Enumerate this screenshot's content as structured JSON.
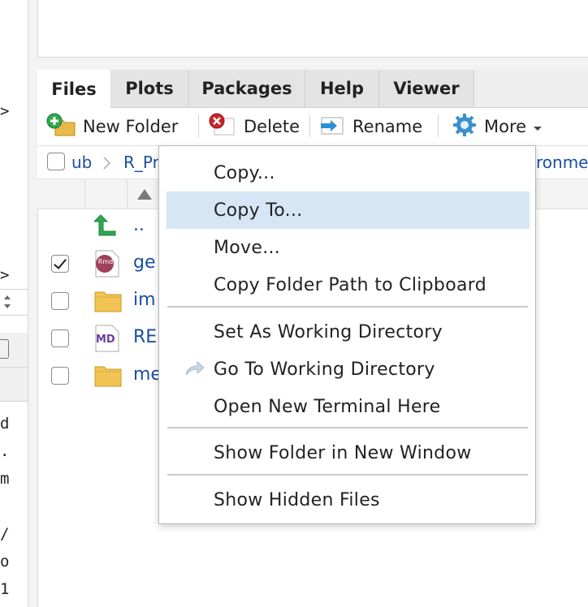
{
  "left_strip": {
    "prompts": [
      ">",
      ">"
    ],
    "mono_lines": [
      "d",
      ".",
      "m",
      "",
      "/",
      "o",
      "1"
    ]
  },
  "tabs": [
    {
      "label": "Files",
      "active": true
    },
    {
      "label": "Plots",
      "active": false
    },
    {
      "label": "Packages",
      "active": false
    },
    {
      "label": "Help",
      "active": false
    },
    {
      "label": "Viewer",
      "active": false
    }
  ],
  "toolbar": {
    "new_folder": "New Folder",
    "delete": "Delete",
    "rename": "Rename",
    "more": "More",
    "icons": {
      "new_folder": "folder-add-icon",
      "delete": "delete-icon",
      "rename": "rename-icon",
      "more": "gear-icon"
    }
  },
  "breadcrumb": {
    "items": [
      "ub",
      "R_Pr",
      "ronme"
    ]
  },
  "files": [
    {
      "name": "..",
      "icon": "up-arrow-icon",
      "checked": null
    },
    {
      "name": "ge",
      "icon": "rmd-file-icon",
      "checked": true
    },
    {
      "name": "im",
      "icon": "folder-icon",
      "checked": false
    },
    {
      "name": "RE",
      "icon": "md-file-icon",
      "checked": false
    },
    {
      "name": "me",
      "icon": "folder-icon",
      "checked": false
    }
  ],
  "icon_text": {
    "rmd": "Rmd",
    "md": "MD"
  },
  "context_menu": {
    "items": [
      "Copy...",
      "Copy To...",
      "Move...",
      "Copy Folder Path to Clipboard",
      "Set As Working Directory",
      "Go To Working Directory",
      "Open New Terminal Here",
      "Show Folder in New Window",
      "Show Hidden Files"
    ],
    "highlighted": "Copy To..."
  },
  "colors": {
    "link": "#1b4fa0",
    "highlight": "#d6e6f5",
    "accent_green": "#2fa84f",
    "delete_red": "#c8262b"
  }
}
